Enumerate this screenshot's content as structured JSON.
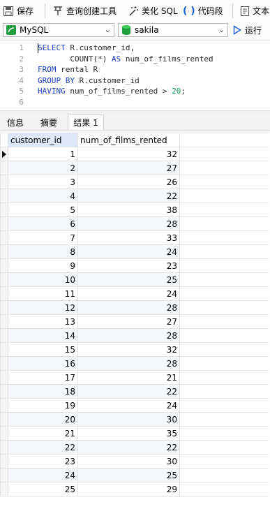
{
  "toolbar": {
    "save": "保存",
    "query_builder": "查询创建工具",
    "beautify_sql": "美化 SQL",
    "code_snippet": "代码段",
    "text": "文本"
  },
  "connection": {
    "selected": "MySQL"
  },
  "database": {
    "selected": "sakila"
  },
  "run_label": "运行",
  "editor": {
    "line_numbers": [
      "1",
      "2",
      "3",
      "4",
      "5",
      "6"
    ],
    "lines": [
      [
        {
          "t": "SELECT",
          "c": "kw"
        },
        {
          "t": " R.customer_id,",
          "c": ""
        }
      ],
      [
        {
          "t": "       COUNT(*) ",
          "c": ""
        },
        {
          "t": "AS",
          "c": "kw"
        },
        {
          "t": " num_of_films_rented",
          "c": ""
        }
      ],
      [
        {
          "t": "FROM",
          "c": "kw"
        },
        {
          "t": " rental R",
          "c": ""
        }
      ],
      [
        {
          "t": "GROUP BY",
          "c": "kw"
        },
        {
          "t": " R.customer_id",
          "c": ""
        }
      ],
      [
        {
          "t": "HAVING",
          "c": "kw"
        },
        {
          "t": " num_of_films_rented > ",
          "c": ""
        },
        {
          "t": "20",
          "c": "num"
        },
        {
          "t": ";",
          "c": ""
        }
      ],
      []
    ]
  },
  "tabs": [
    "信息",
    "摘要",
    "结果 1"
  ],
  "results": {
    "columns": [
      "customer_id",
      "num_of_films_rented"
    ],
    "rows": [
      [
        "1",
        "32"
      ],
      [
        "2",
        "27"
      ],
      [
        "3",
        "26"
      ],
      [
        "4",
        "22"
      ],
      [
        "5",
        "38"
      ],
      [
        "6",
        "28"
      ],
      [
        "7",
        "33"
      ],
      [
        "8",
        "24"
      ],
      [
        "9",
        "23"
      ],
      [
        "10",
        "25"
      ],
      [
        "11",
        "24"
      ],
      [
        "12",
        "28"
      ],
      [
        "13",
        "27"
      ],
      [
        "14",
        "28"
      ],
      [
        "15",
        "32"
      ],
      [
        "16",
        "28"
      ],
      [
        "17",
        "21"
      ],
      [
        "18",
        "22"
      ],
      [
        "19",
        "24"
      ],
      [
        "20",
        "30"
      ],
      [
        "21",
        "35"
      ],
      [
        "22",
        "22"
      ],
      [
        "23",
        "30"
      ],
      [
        "24",
        "25"
      ],
      [
        "25",
        "29"
      ]
    ]
  }
}
